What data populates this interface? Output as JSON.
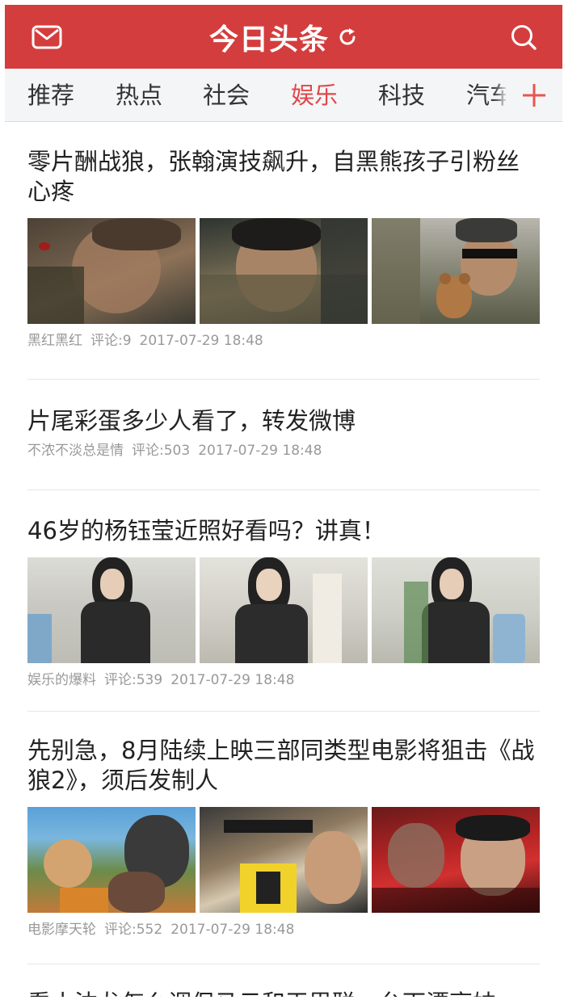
{
  "header": {
    "title": "今日头条",
    "mail_icon": "mail-icon",
    "refresh_icon": "refresh-icon",
    "search_icon": "search-icon",
    "background_color": "#d43d3d"
  },
  "tabs": {
    "items": [
      {
        "label": "推荐",
        "active": false
      },
      {
        "label": "热点",
        "active": false
      },
      {
        "label": "社会",
        "active": false
      },
      {
        "label": "娱乐",
        "active": true
      },
      {
        "label": "科技",
        "active": false
      },
      {
        "label": "汽车",
        "active": false
      }
    ],
    "add_icon": "plus-icon",
    "active_color": "#e0474c"
  },
  "feed": {
    "items": [
      {
        "title": "零片酬战狼，张翰演技飙升，自黑熊孩子引粉丝心疼",
        "source": "黑红黑红",
        "comments": "评论:9",
        "time": "2017-07-29 18:48",
        "image_count": 3
      },
      {
        "title": "片尾彩蛋多少人看了，转发微博",
        "source": "不浓不淡总是情",
        "comments": "评论:503",
        "time": "2017-07-29 18:48",
        "image_count": 0
      },
      {
        "title": "46岁的杨钰莹近照好看吗？讲真！",
        "source": "娱乐的爆料",
        "comments": "评论:539",
        "time": "2017-07-29 18:48",
        "image_count": 3
      },
      {
        "title": "先别急，8月陆续上映三部同类型电影将狙击《战狼2》，须后发制人",
        "source": "电影摩天轮",
        "comments": "评论:552",
        "time": "2017-07-29 18:48",
        "image_count": 3
      },
      {
        "title": "看小沈龙怎么调侃马云和王思聪，台下漂亮妹",
        "source": "",
        "comments": "",
        "time": "",
        "image_count": 0
      }
    ]
  }
}
